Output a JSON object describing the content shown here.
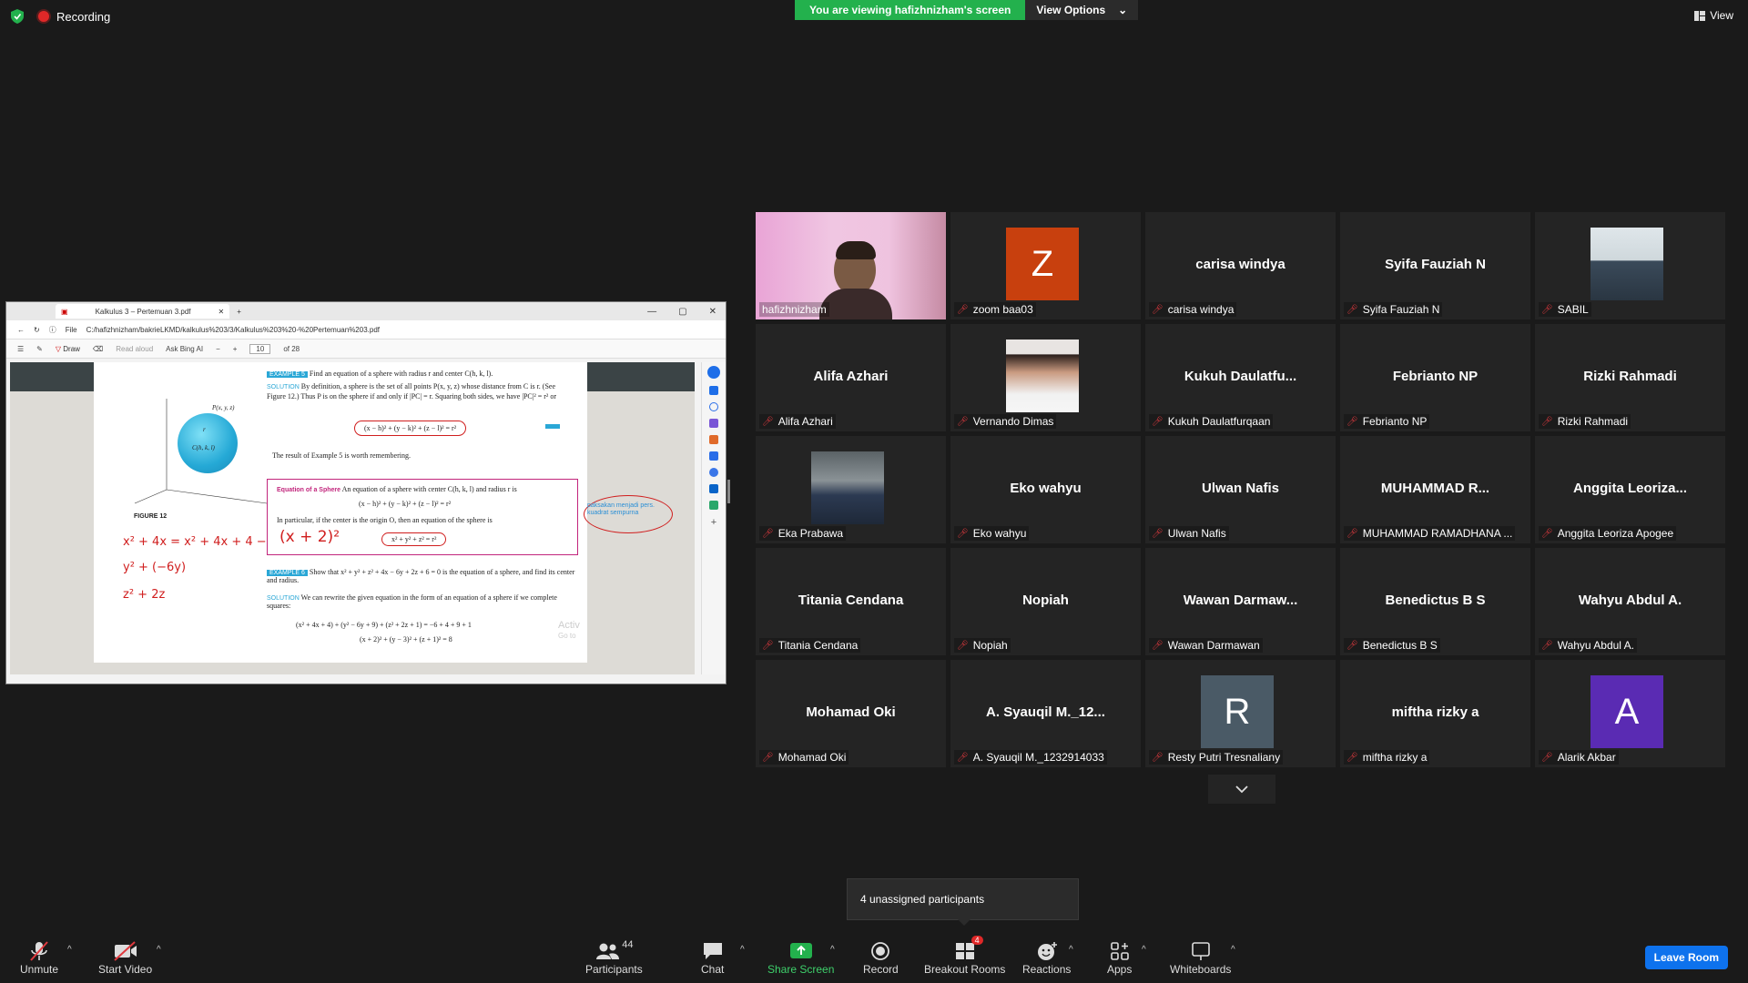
{
  "top": {
    "recording": "Recording",
    "banner": "You are viewing hafizhnizham's screen",
    "view_options": "View Options",
    "view": "View"
  },
  "browser": {
    "tab_title": "Kalkulus 3 – Pertemuan 3.pdf",
    "address_prefix": "File",
    "address": "C:/hafizhnizham/bakrieLKMD/kalkulus%203/3/Kalkulus%203%20-%20Pertemuan%203.pdf",
    "draw": "Draw",
    "read_aloud": "Read aloud",
    "ask_bing": "Ask Bing AI",
    "page_current": "10",
    "page_total": "of 28"
  },
  "document": {
    "example5_tag": "EXAMPLE 5",
    "example5_text": "Find an equation of a sphere with radius r and center C(h, k, l).",
    "solution_tag": "SOLUTION",
    "solution_text": "By definition, a sphere is the set of all points P(x, y, z) whose distance from C is r. (See Figure 12.) Thus P is on the sphere if and only if |PC| = r. Squaring both sides, we have |PC|² = r² or",
    "eq1": "(x − h)² + (y − k)² + (z − l)² = r²",
    "remember": "The result of Example 5 is worth remembering.",
    "box_title": "Equation of a Sphere",
    "box_text": "An equation of a sphere with center C(h, k, l) and radius r is",
    "box_eq": "(x − h)² + (y − k)² + (z − l)² = r²",
    "box_text2": "In particular, if the center is the origin O, then an equation of the sphere is",
    "box_eq2": "x² + y² + z² = r²",
    "figure": "FIGURE 12",
    "fig_p": "P(x, y, z)",
    "fig_c": "C(h, k, l)",
    "fig_r": "r",
    "example6_tag": "EXAMPLE 6",
    "example6_text": "Show that x² + y² + z² + 4x − 6y + 2z + 6 = 0 is the equation of a sphere, and find its center and radius.",
    "solution2_text": "We can rewrite the given equation in the form of an equation of a sphere if we complete squares:",
    "eq3": "(x² + 4x + 4) + (y² − 6y + 9) + (z² + 2z + 1) = −6 + 4 + 9 + 1",
    "eq4": "(x + 2)² + (y − 3)² + (z + 1)² = 8",
    "annotation": "paksakan menjadi pers. kuadrat sempurna",
    "ink1": "x² + 4x = x² + 4x + 4 −",
    "ink1b": "(x + 2)²",
    "ink2": "y² + (−6y)",
    "ink3": "z² + 2z",
    "watermark": "Activ",
    "watermark2": "Go to"
  },
  "participants_tiles": [
    {
      "display": "",
      "label": "hafizhnizham",
      "kind": "video",
      "muted": false
    },
    {
      "display": "Z",
      "label": "zoom baa03",
      "kind": "avatar",
      "color": "#c8400e",
      "muted": true
    },
    {
      "display": "carisa windya",
      "label": "carisa windya",
      "kind": "name",
      "muted": true
    },
    {
      "display": "Syifa Fauziah N",
      "label": "Syifa Fauziah N",
      "kind": "name",
      "muted": true
    },
    {
      "display": "",
      "label": "SABIL",
      "kind": "photo-sabil",
      "muted": true
    },
    {
      "display": "Alifa Azhari",
      "label": "Alifa Azhari",
      "kind": "name",
      "muted": true
    },
    {
      "display": "",
      "label": "Vernando Dimas",
      "kind": "photo-woman",
      "muted": true
    },
    {
      "display": "Kukuh  Daulatfu...",
      "label": "Kukuh Daulatfurqaan",
      "kind": "name",
      "muted": true
    },
    {
      "display": "Febrianto NP",
      "label": "Febrianto NP",
      "kind": "name",
      "muted": true
    },
    {
      "display": "Rizki Rahmadi",
      "label": "Rizki Rahmadi",
      "kind": "name",
      "muted": true
    },
    {
      "display": "",
      "label": "Eka Prabawa",
      "kind": "photo-worker",
      "muted": true
    },
    {
      "display": "Eko wahyu",
      "label": "Eko wahyu",
      "kind": "name",
      "muted": true
    },
    {
      "display": "Ulwan Nafis",
      "label": "Ulwan Nafis",
      "kind": "name",
      "muted": true
    },
    {
      "display": "MUHAMMAD  R...",
      "label": "MUHAMMAD RAMADHANA ...",
      "kind": "name",
      "muted": true
    },
    {
      "display": "Anggita  Leoriza...",
      "label": "Anggita Leoriza Apogee",
      "kind": "name",
      "muted": true
    },
    {
      "display": "Titania Cendana",
      "label": "Titania Cendana",
      "kind": "name",
      "muted": true
    },
    {
      "display": "Nopiah",
      "label": "Nopiah",
      "kind": "name",
      "muted": true
    },
    {
      "display": "Wawan  Darmaw...",
      "label": "Wawan Darmawan",
      "kind": "name",
      "muted": true
    },
    {
      "display": "Benedictus B S",
      "label": "Benedictus B S",
      "kind": "name",
      "muted": true
    },
    {
      "display": "Wahyu Abdul A.",
      "label": "Wahyu Abdul A.",
      "kind": "name",
      "muted": true
    },
    {
      "display": "Mohamad Oki",
      "label": "Mohamad Oki",
      "kind": "name",
      "muted": true
    },
    {
      "display": "A.  Syauqil  M._12...",
      "label": "A. Syauqil M._1232914033",
      "kind": "name",
      "muted": true
    },
    {
      "display": "R",
      "label": "Resty Putri Tresnaliany",
      "kind": "avatar",
      "color": "#4a5a66",
      "muted": true
    },
    {
      "display": "miftha rizky a",
      "label": "miftha rizky a",
      "kind": "name",
      "muted": true
    },
    {
      "display": "A",
      "label": "Alarik Akbar",
      "kind": "avatar",
      "color": "#5a2bb3",
      "muted": true
    }
  ],
  "unassigned": "4 unassigned participants",
  "toolbar": {
    "unmute": "Unmute",
    "start_video": "Start Video",
    "participants": "Participants",
    "participants_count": "44",
    "chat": "Chat",
    "share_screen": "Share Screen",
    "record": "Record",
    "breakout": "Breakout Rooms",
    "breakout_badge": "4",
    "reactions": "Reactions",
    "apps": "Apps",
    "whiteboards": "Whiteboards",
    "leave": "Leave Room"
  },
  "colors": {
    "share_green": "#23b14d",
    "leave_blue": "#0e72ed",
    "active_speaker": "#d7ea5b",
    "muted_red": "#e0393e"
  }
}
